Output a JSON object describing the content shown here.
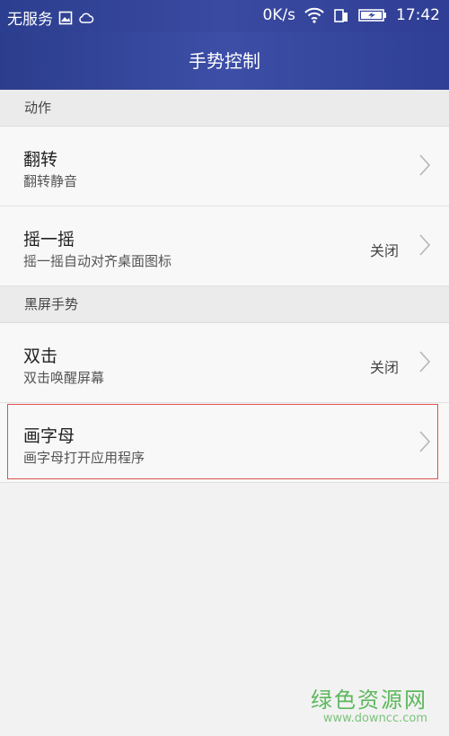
{
  "status_bar": {
    "carrier": "无服务",
    "speed": "0K/s",
    "time": "17:42",
    "icons": [
      "image-icon",
      "cloud-icon",
      "wifi-icon",
      "sim-icon",
      "battery-charging-icon"
    ]
  },
  "app_bar": {
    "title": "手势控制"
  },
  "sections": [
    {
      "header": "动作",
      "items": [
        {
          "title": "翻转",
          "subtitle": "翻转静音",
          "value": ""
        },
        {
          "title": "摇一摇",
          "subtitle": "摇一摇自动对齐桌面图标",
          "value": "关闭"
        }
      ]
    },
    {
      "header": "黑屏手势",
      "items": [
        {
          "title": "双击",
          "subtitle": "双击唤醒屏幕",
          "value": "关闭"
        },
        {
          "title": "画字母",
          "subtitle": "画字母打开应用程序",
          "value": ""
        }
      ]
    }
  ],
  "watermark": {
    "brand": "绿色资源网",
    "url": "www.downcc.com"
  },
  "colors": {
    "bar": "#2f3f95",
    "highlight": "#d9534f",
    "watermark": "#5cb85c"
  }
}
